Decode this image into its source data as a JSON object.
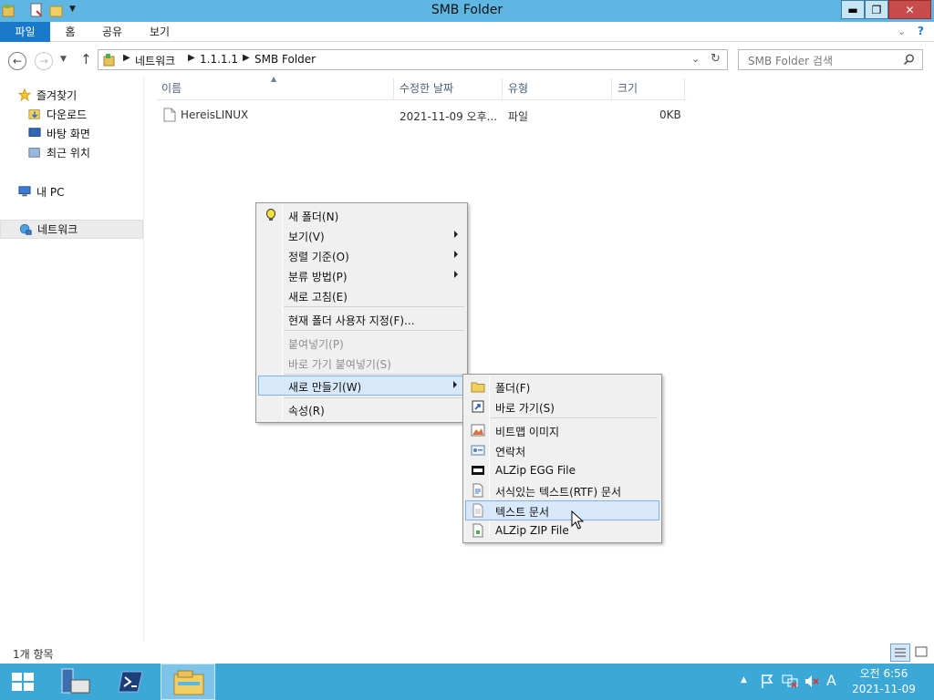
{
  "window": {
    "title": "SMB Folder",
    "controls": {
      "minimize": "▬",
      "restore": "❐",
      "close": "✕"
    }
  },
  "ribbon": {
    "tabs": [
      "파일",
      "홈",
      "공유",
      "보기"
    ]
  },
  "address": {
    "crumbs": [
      "네트워크",
      "1.1.1.1",
      "SMB Folder"
    ],
    "search_placeholder": "SMB Folder 검색"
  },
  "nav": {
    "favorites": "즐겨찾기",
    "downloads": "다운로드",
    "desktop": "바탕 화면",
    "recent": "최근 위치",
    "this_pc": "내 PC",
    "network": "네트워크"
  },
  "columns": {
    "name": "이름",
    "modified": "수정한 날짜",
    "type": "유형",
    "size": "크기"
  },
  "files": [
    {
      "name": "HereisLINUX",
      "modified": "2021-11-09 오후...",
      "type": "파일",
      "size": "0KB"
    }
  ],
  "context_menu": {
    "new_folder": "새 폴더(N)",
    "view": "보기(V)",
    "sort_by": "정렬 기준(O)",
    "group_by": "분류 방법(P)",
    "refresh": "새로 고침(E)",
    "customize": "현재 폴더 사용자 지정(F)...",
    "paste": "붙여넣기(P)",
    "paste_shortcut": "바로 가기 붙여넣기(S)",
    "new": "새로 만들기(W)",
    "properties": "속성(R)"
  },
  "new_submenu": {
    "folder": "폴더(F)",
    "shortcut": "바로 가기(S)",
    "bitmap": "비트맵 이미지",
    "contact": "연락처",
    "alzip_egg": "ALZip EGG File",
    "rtf": "서식있는 텍스트(RTF) 문서",
    "text": "텍스트 문서",
    "alzip_zip": "ALZip ZIP File"
  },
  "status": {
    "item_count": "1개 항목"
  },
  "taskbar": {
    "clock_time": "오전 6:56",
    "clock_date": "2021-11-09",
    "ime": "A"
  },
  "colors": {
    "titlebar": "#5fb6e3",
    "file_tab": "#1979ca",
    "taskbar": "#3ca8d8",
    "menu_highlight": "#d7e8fa",
    "close_button": "#c74c4c"
  }
}
